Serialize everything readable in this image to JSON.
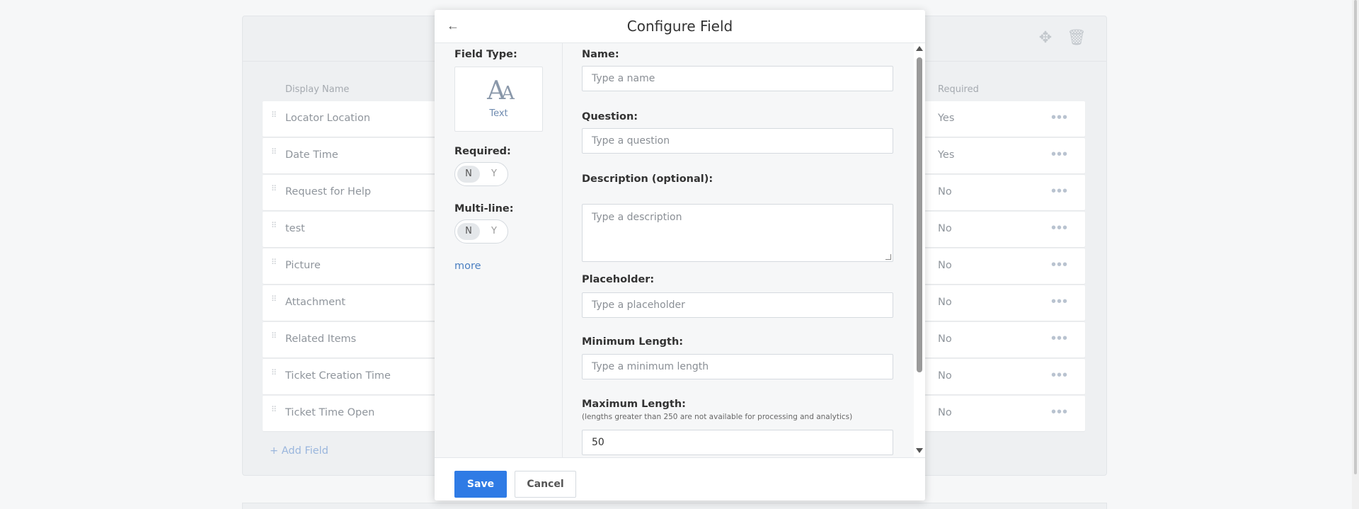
{
  "background": {
    "columns": {
      "display_name": "Display Name",
      "required": "Required"
    },
    "rows": [
      {
        "name": "Locator Location",
        "required": "Yes"
      },
      {
        "name": "Date Time",
        "required": "Yes"
      },
      {
        "name": "Request for Help",
        "required": "No"
      },
      {
        "name": "test",
        "required": "No"
      },
      {
        "name": "Picture",
        "required": "No"
      },
      {
        "name": "Attachment",
        "required": "No"
      },
      {
        "name": "Related Items",
        "required": "No"
      },
      {
        "name": "Ticket Creation Time",
        "required": "No"
      },
      {
        "name": "Ticket Time Open",
        "required": "No"
      }
    ],
    "add_field": "+ Add Field",
    "row_menu_glyph": "•••",
    "grip_glyph": "⠿",
    "move_icon_glyph": "✥",
    "trash_icon_glyph": "🗑"
  },
  "modal": {
    "title": "Configure Field",
    "back_glyph": "←",
    "left": {
      "field_type_label": "Field Type:",
      "field_type_glyph_big": "A",
      "field_type_glyph_small": "A",
      "field_type_name": "Text",
      "required_label": "Required:",
      "required_toggle": {
        "no": "N",
        "yes": "Y",
        "selected": "N"
      },
      "multiline_label": "Multi-line:",
      "multiline_toggle": {
        "no": "N",
        "yes": "Y",
        "selected": "N"
      },
      "more": "more"
    },
    "right": {
      "name_label": "Name:",
      "name_placeholder": "Type a name",
      "question_label": "Question:",
      "question_placeholder": "Type a question",
      "description_label": "Description (optional):",
      "description_placeholder": "Type a description",
      "placeholder_label": "Placeholder:",
      "placeholder_placeholder": "Type a placeholder",
      "min_length_label": "Minimum Length:",
      "min_length_placeholder": "Type a minimum length",
      "max_length_label": "Maximum Length:",
      "max_length_hint": "(lengths greater than 250 are not available for processing and analytics)",
      "max_length_value": "50"
    },
    "footer": {
      "save": "Save",
      "cancel": "Cancel"
    }
  },
  "colors": {
    "primary_button": "#2f7be5",
    "link": "#4a7fc1"
  }
}
